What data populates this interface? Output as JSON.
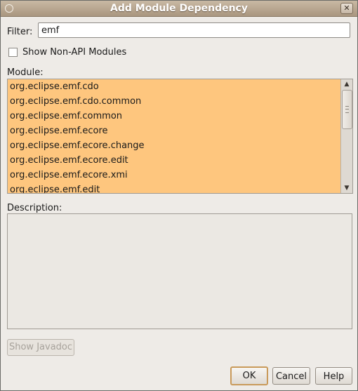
{
  "window": {
    "title": "Add Module Dependency",
    "close_glyph": "✕"
  },
  "filter": {
    "label": "Filter:",
    "value": "emf"
  },
  "non_api": {
    "label": "Show Non-API Modules",
    "checked": false
  },
  "modules": {
    "label": "Module:",
    "items": [
      "org.eclipse.emf.cdo",
      "org.eclipse.emf.cdo.common",
      "org.eclipse.emf.common",
      "org.eclipse.emf.ecore",
      "org.eclipse.emf.ecore.change",
      "org.eclipse.emf.ecore.edit",
      "org.eclipse.emf.ecore.xmi",
      "org.eclipse.emf.edit"
    ],
    "highlight_color": "#fec67e",
    "scroll_up_glyph": "▲",
    "scroll_down_glyph": "▼"
  },
  "description": {
    "label": "Description:"
  },
  "buttons": {
    "javadoc": "Show Javadoc",
    "ok": "OK",
    "cancel": "Cancel",
    "help": "Help"
  }
}
